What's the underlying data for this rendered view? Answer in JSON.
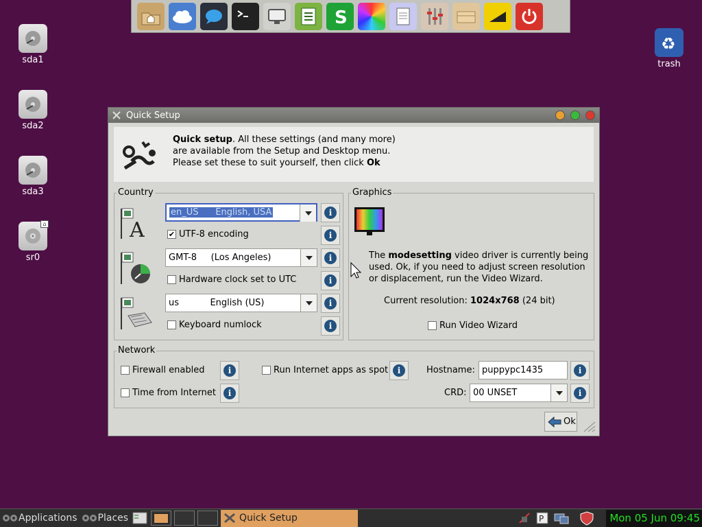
{
  "desktop": {
    "icons": [
      {
        "label": "sda1"
      },
      {
        "label": "sda2"
      },
      {
        "label": "sda3"
      },
      {
        "label": "sr0"
      },
      {
        "label": "trash"
      }
    ]
  },
  "dock": {
    "items": [
      "home-folder-icon",
      "cloud-icon",
      "chat-icon",
      "terminal-icon",
      "monitor-icon",
      "document-icon",
      "spreadsheet-icon",
      "color-wheel-icon",
      "text-file-icon",
      "mixer-icon",
      "folder-icon",
      "signal-icon",
      "power-icon"
    ]
  },
  "window": {
    "title": "Quick Setup",
    "banner": {
      "bold1": "Quick setup",
      "line1_rest": ". All these settings (and many more)",
      "line2": "are available from the Setup and Desktop menu.",
      "line3_pre": "Please set these to suit yourself, then click ",
      "line3_bold": "Ok"
    },
    "country": {
      "label": "Country",
      "locale_value": "en_US      English, USA",
      "utf8_label": "UTF-8 encoding",
      "utf8_checked": true,
      "timezone_value": "GMT-8     (Los Angeles)",
      "hwclock_label": "Hardware clock set to UTC",
      "keyboard_value": "us           English (US)",
      "numlock_label": "Keyboard numlock"
    },
    "graphics": {
      "label": "Graphics",
      "desc_pre": "The ",
      "desc_bold": "modesetting",
      "desc_rest1": " video driver is currently being",
      "desc_line2": "used. Ok, if you need to adjust screen resolution",
      "desc_line3": "or displacement, run the Video Wizard.",
      "res_pre": "Current resolution: ",
      "res_bold": "1024x768",
      "res_post": "  (24 bit)",
      "wizard_label": "Run Video Wizard"
    },
    "network": {
      "label": "Network",
      "firewall_label": "Firewall enabled",
      "time_label": "Time from Internet",
      "spot_label": "Run Internet apps as spot",
      "hostname_label": "Hostname:",
      "hostname_value": "puppypc1435",
      "crd_label": "CRD:",
      "crd_value": "00 UNSET"
    },
    "ok_label": "Ok",
    "info_glyph": "i"
  },
  "taskbar": {
    "applications": "Applications",
    "places": "Places",
    "task": "Quick Setup",
    "clock": "Mon 05 Jun 09:45"
  },
  "colors": {
    "desktop": "#4e0f45",
    "clock": "#20e020",
    "task_active": "#e0a060"
  }
}
